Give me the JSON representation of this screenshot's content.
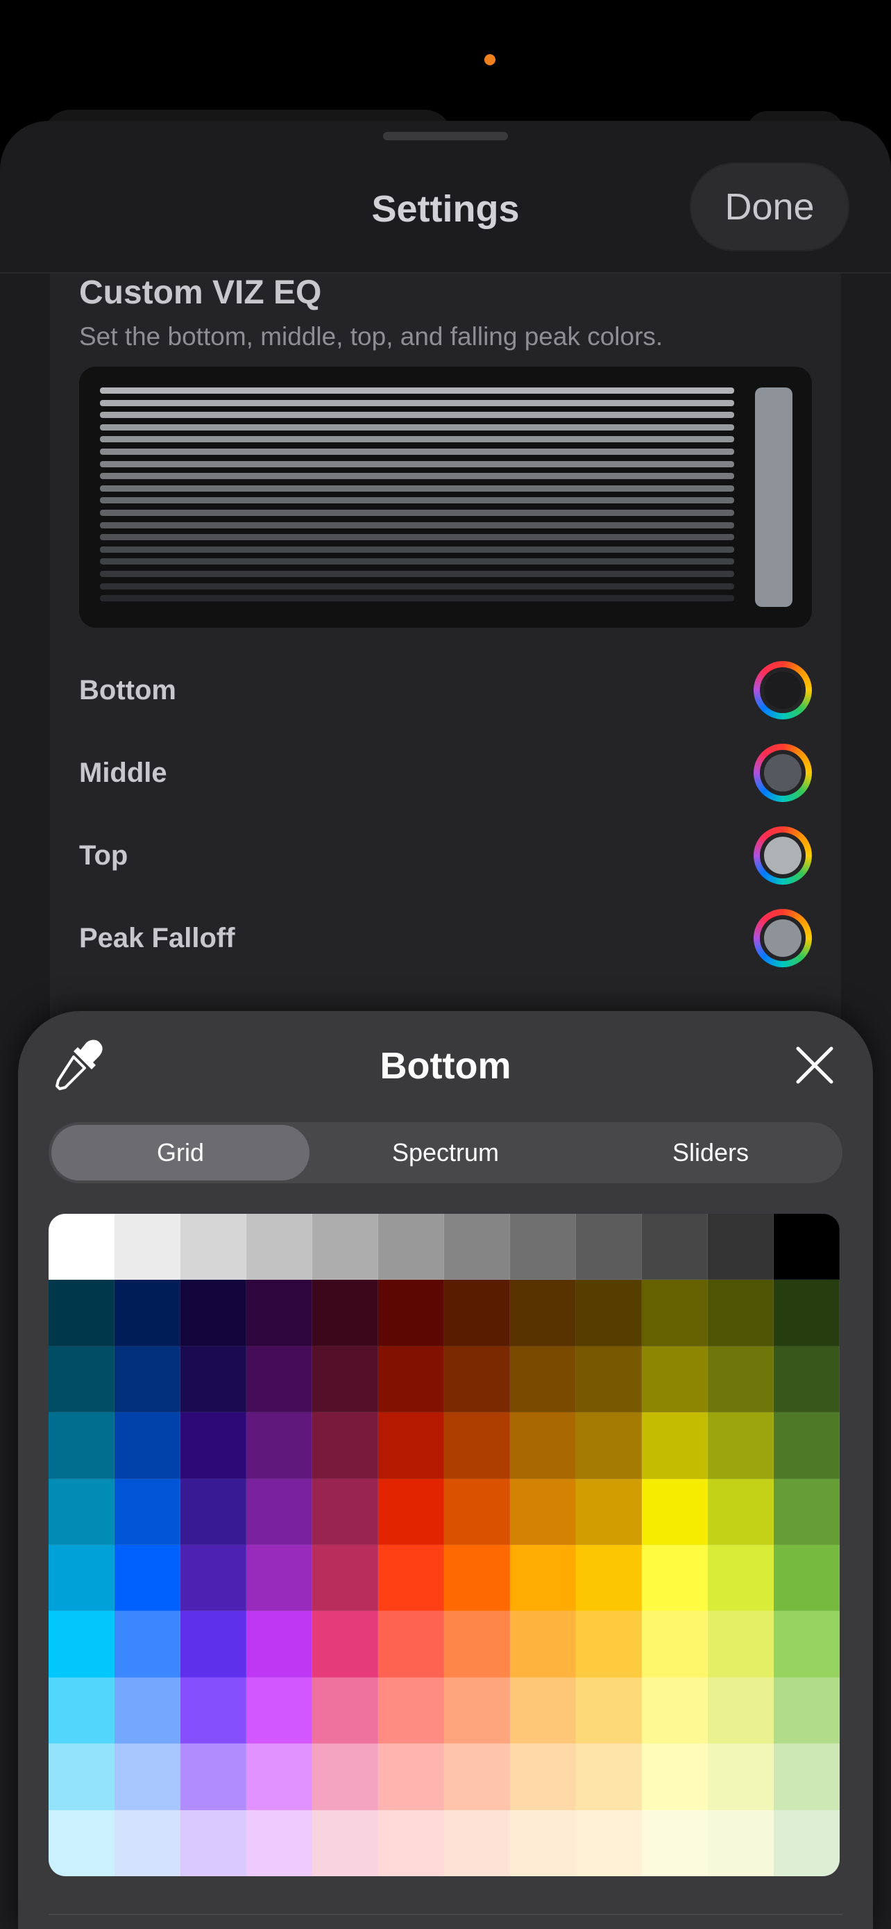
{
  "nav": {
    "title": "Settings",
    "done_label": "Done"
  },
  "section": {
    "title": "Custom VIZ EQ",
    "subtitle": "Set the bottom, middle, top, and falling peak colors."
  },
  "color_rows": [
    {
      "label": "Bottom",
      "color": "#1c1c1e"
    },
    {
      "label": "Middle",
      "color": "#55585e"
    },
    {
      "label": "Top",
      "color": "#aeb1b6"
    },
    {
      "label": "Peak Falloff",
      "color": "#8e939a"
    }
  ],
  "picker": {
    "title": "Bottom",
    "tabs": [
      "Grid",
      "Spectrum",
      "Sliders"
    ],
    "selected_tab": "Grid",
    "grid_colors": [
      [
        "#ffffff",
        "#ebebeb",
        "#d6d6d6",
        "#c2c2c2",
        "#adadad",
        "#999999",
        "#858585",
        "#707070",
        "#5c5c5c",
        "#474747",
        "#333333",
        "#000000"
      ],
      [
        "#00374a",
        "#011d57",
        "#11053b",
        "#2e063d",
        "#3c071b",
        "#5c0701",
        "#5a1c00",
        "#583300",
        "#563d00",
        "#666100",
        "#4f5504",
        "#263e0f"
      ],
      [
        "#004d65",
        "#012f7b",
        "#1a0a52",
        "#450d59",
        "#551029",
        "#831100",
        "#7b2900",
        "#7a4a00",
        "#785800",
        "#8d8602",
        "#6f760a",
        "#38571a"
      ],
      [
        "#016e8f",
        "#0042a9",
        "#2c0977",
        "#61187c",
        "#791a3d",
        "#b51a00",
        "#ad3e00",
        "#a96800",
        "#a67b01",
        "#c4bc00",
        "#9ba50e",
        "#4e7a27"
      ],
      [
        "#008cb4",
        "#0056d6",
        "#371a94",
        "#7a219e",
        "#99244f",
        "#e22400",
        "#da5100",
        "#d38301",
        "#d19d01",
        "#f5ec00",
        "#c3d117",
        "#669d34"
      ],
      [
        "#00a1d8",
        "#0061fe",
        "#4d22b2",
        "#982abc",
        "#b92d5d",
        "#ff4015",
        "#ff6a00",
        "#ffab01",
        "#fcc700",
        "#fefb41",
        "#d9ec37",
        "#76bb40"
      ],
      [
        "#01c7fc",
        "#3a87fe",
        "#5e30eb",
        "#be38f3",
        "#e63b7a",
        "#fe6250",
        "#fe8648",
        "#feb43f",
        "#fecb3e",
        "#fff76b",
        "#e4ef65",
        "#96d35f"
      ],
      [
        "#52d6fc",
        "#74a7ff",
        "#864ffe",
        "#d357fe",
        "#ee719e",
        "#ff8c82",
        "#fea57d",
        "#fec777",
        "#fed977",
        "#fff994",
        "#eaf28f",
        "#b1dd8b"
      ],
      [
        "#93e3fc",
        "#a7c6ff",
        "#b18cfe",
        "#e292fe",
        "#f4a4c0",
        "#ffb5af",
        "#ffc5ab",
        "#fed9a8",
        "#fde4a8",
        "#fffbb9",
        "#f1f7b7",
        "#cde8b5"
      ],
      [
        "#cbf0ff",
        "#d3e2ff",
        "#d9c9fe",
        "#efcaff",
        "#f9d3e0",
        "#ffdad8",
        "#ffe2d6",
        "#feecd4",
        "#fef1d5",
        "#fdfbdd",
        "#f6fadb",
        "#deeed4"
      ]
    ]
  },
  "colors": {
    "accent_status": "#f0801e",
    "sheet_bg": "#1c1c1e",
    "panel_bg": "#242426",
    "picker_bg": "#3a3a3c"
  },
  "icons": {
    "eyedropper": "eyedropper-icon",
    "close": "close-icon"
  }
}
